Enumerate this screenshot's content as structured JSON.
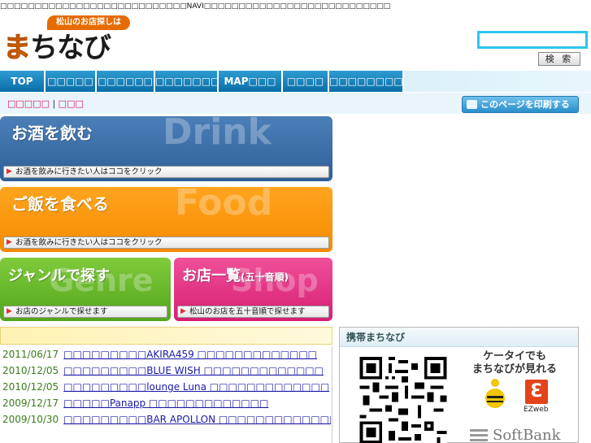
{
  "site_description": "□□□□□□□□□□□□□□□□□□□□□□□□□□□NAVI□□□□□□□□□□□□□□□□□□□□□□□□□□□",
  "logo": {
    "tagline": "松山のお店探しは",
    "wordmark_first": "ま",
    "wordmark_rest": "ちなび"
  },
  "search": {
    "value": "",
    "button_label": "検 索"
  },
  "nav": [
    {
      "label": "TOP"
    },
    {
      "label": "□□□□□"
    },
    {
      "label": "□□□□□□"
    },
    {
      "label": "□□□□□□□"
    },
    {
      "label": "MAP□□□"
    },
    {
      "label": "□□□□"
    },
    {
      "label": "□□□□□□□□□□"
    }
  ],
  "breadcrumb": {
    "first": "□□□□□",
    "separator": " | ",
    "second": "□□□"
  },
  "print_button_label": "このページを印刷する",
  "banners": {
    "drink": {
      "title": "お酒を飲む",
      "watermark": "Drink",
      "bar_text": "お酒を飲みに行きたい人はココをクリック"
    },
    "food": {
      "title": "ご飯を食べる",
      "watermark": "Food",
      "bar_text": "お酒を飲みに行きたい人はココをクリック"
    },
    "genre": {
      "title": "ジャンルで探す",
      "watermark": "Genre",
      "bar_text": "お店のジャンルで探せます"
    },
    "shop": {
      "title": "お店一覧",
      "title_sub": "(五十音順)",
      "watermark": "Shop",
      "bar_text": "松山のお店を五十音順で探せます"
    }
  },
  "news_header": "",
  "news": [
    {
      "date": "2011/06/17",
      "text": "□□□□□□□□□AKIRA459 □□□□□□□□□□□□□"
    },
    {
      "date": "2010/12/05",
      "text": "□□□□□□□□□BLUE WISH □□□□□□□□□□□□□"
    },
    {
      "date": "2010/12/05",
      "text": "□□□□□□□□□lounge Luna □□□□□□□□□□□□□"
    },
    {
      "date": "2009/12/17",
      "text": "□□□□□Panapp □□□□□□□□□□□□□"
    },
    {
      "date": "2009/10/30",
      "text": "□□□□□□□□□BAR APOLLON □□□□□□□□□□□□□"
    }
  ],
  "mobile": {
    "header": "携帯まちなび",
    "copy_line1": "ケータイでも",
    "copy_line2": "まちなびが見れる",
    "ezweb_label": "EZweb",
    "softbank_label": "SoftBank"
  },
  "colors": {
    "nav_blue": "#0a6ea8",
    "search_border": "#2ec5ec",
    "drink": "#2e5f97",
    "food": "#f58a00",
    "genre": "#53a51c",
    "shop": "#d61e72",
    "news_date": "#3a7d1a",
    "news_link": "#1a1aa8",
    "breadcrumb_link": "#d10d5f"
  }
}
